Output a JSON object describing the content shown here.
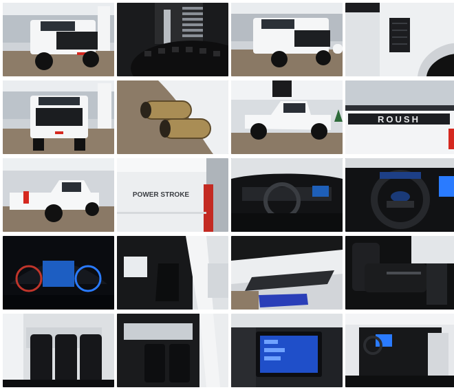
{
  "gallery": {
    "rows": 5,
    "columns": 4,
    "photos": [
      {
        "subject": "truck-front-three-quarter"
      },
      {
        "subject": "lift-kit-coilover-and-tire"
      },
      {
        "subject": "truck-front-three-quarter-alt"
      },
      {
        "subject": "fender-vent"
      },
      {
        "subject": "truck-front-grille"
      },
      {
        "subject": "dual-exhaust-tips"
      },
      {
        "subject": "truck-side-profile"
      },
      {
        "subject": "roush-side-graphic",
        "text": "ROUSH"
      },
      {
        "subject": "truck-rear-three-quarter"
      },
      {
        "subject": "power-stroke-badge",
        "text": "POWER STROKE"
      },
      {
        "subject": "dashboard-interior"
      },
      {
        "subject": "steering-wheel"
      },
      {
        "subject": "digital-instrument-cluster"
      },
      {
        "subject": "front-seats-door-open"
      },
      {
        "subject": "illuminated-running-board"
      },
      {
        "subject": "rear-seat-bag"
      },
      {
        "subject": "rear-bench-seats"
      },
      {
        "subject": "rear-seats-door-open"
      },
      {
        "subject": "touchscreen-infotainment"
      },
      {
        "subject": "front-interior-door-open"
      }
    ]
  },
  "colors": {
    "truck_white": "#f1f2f4",
    "showroom_floor": "#7a6a58",
    "interior_black": "#141619",
    "accent_blue": "#2a7bff",
    "accent_red": "#d5281f"
  }
}
